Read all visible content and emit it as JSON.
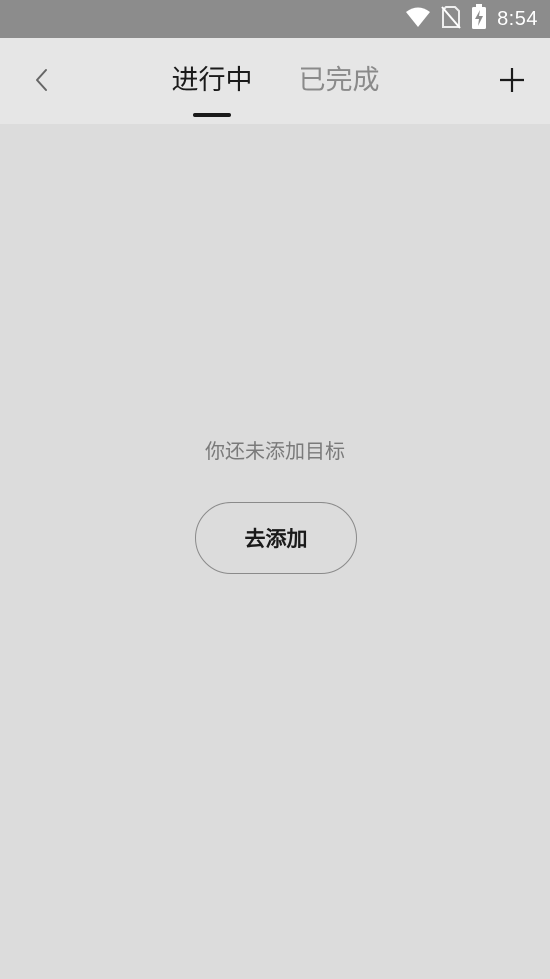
{
  "status_bar": {
    "time": "8:54",
    "icons": [
      "wifi-icon",
      "no-sim-icon",
      "battery-charging-icon"
    ]
  },
  "nav": {
    "back_icon": "chevron-left-icon",
    "tabs": [
      {
        "label": "进行中",
        "active": true
      },
      {
        "label": "已完成",
        "active": false
      }
    ],
    "add_icon": "plus-icon"
  },
  "empty_state": {
    "message": "你还未添加目标",
    "button_label": "去添加"
  },
  "colors": {
    "status_bar_bg": "#8c8c8c",
    "nav_bg": "#e6e6e6",
    "page_bg": "#dcdcdc",
    "active_text": "#1a1a1a",
    "inactive_text": "#8a8a8a"
  }
}
